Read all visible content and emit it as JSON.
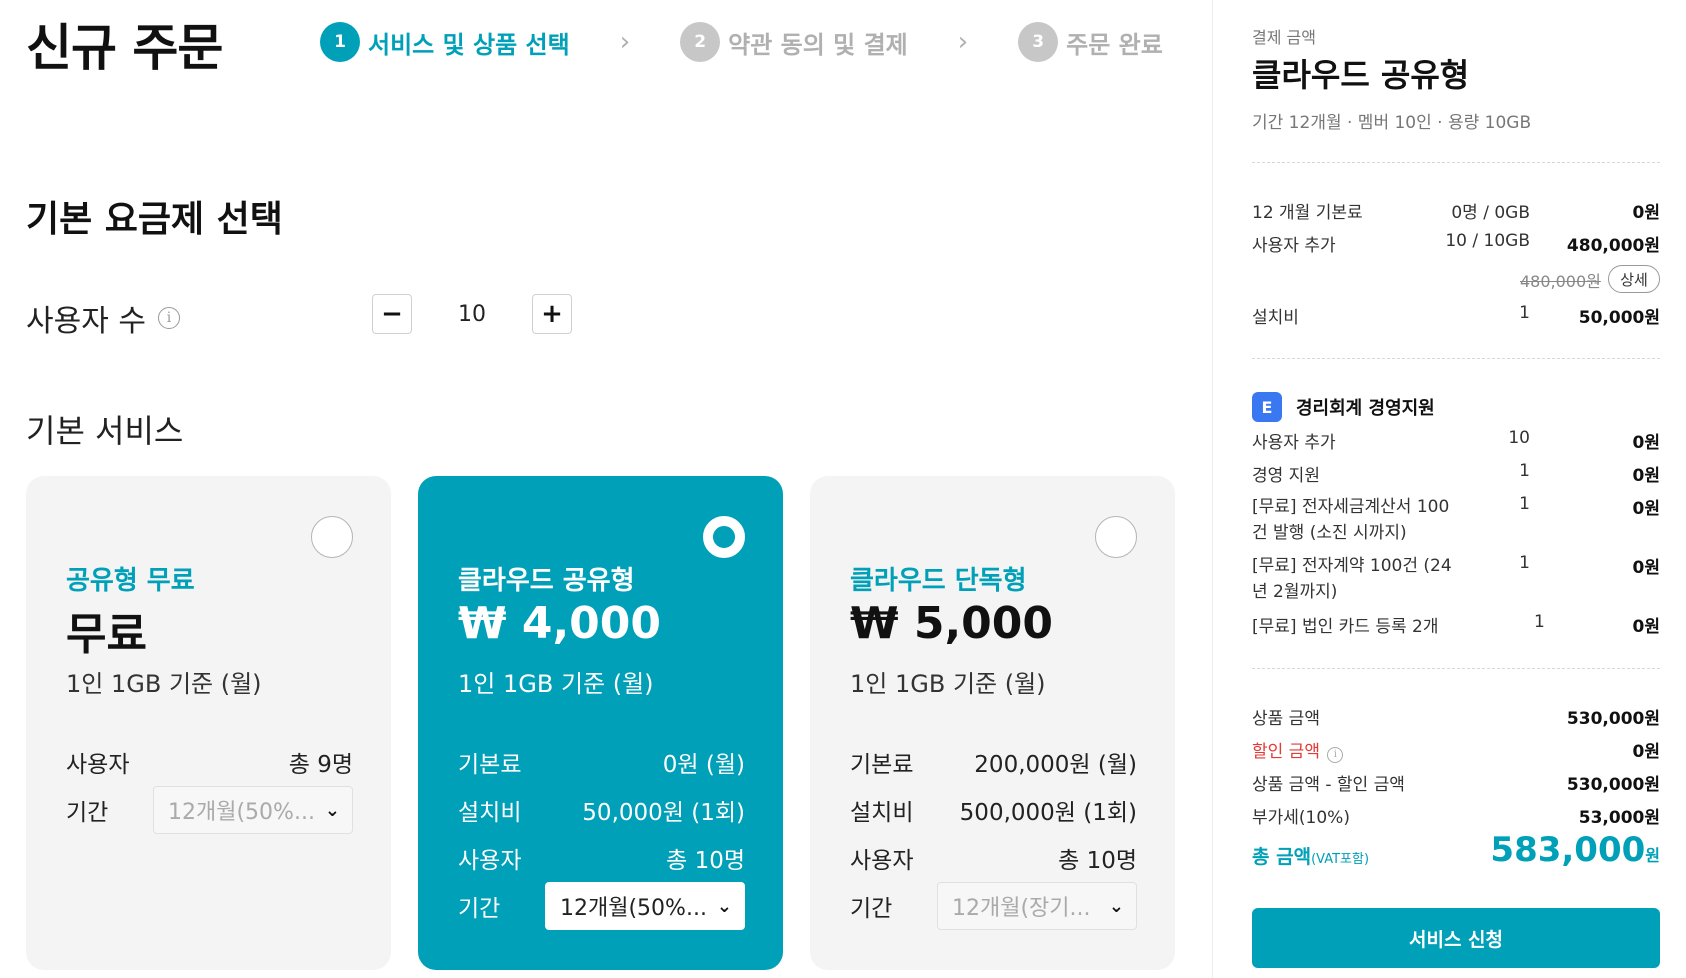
{
  "header": {
    "title": "신규 주문",
    "steps": [
      {
        "num": "1",
        "label": "서비스 및 상품 선택"
      },
      {
        "num": "2",
        "label": "약관 동의 및 결제"
      },
      {
        "num": "3",
        "label": "주문 완료"
      }
    ],
    "arrow": "›"
  },
  "plan_section": {
    "title": "기본 요금제 선택",
    "user_count_label": "사용자 수",
    "info_glyph": "i",
    "minus": "−",
    "plus": "+",
    "user_count": "10",
    "basic_service_title": "기본 서비스"
  },
  "cards": [
    {
      "name": "공유형 무료",
      "price": "무료",
      "basis": "1인 1GB 기준 (월)",
      "rows": [
        {
          "label": "사용자",
          "value": "총 9명"
        }
      ],
      "period_label": "기간",
      "period_value": "12개월(50%...",
      "selected": false
    },
    {
      "name": "클라우드 공유형",
      "price": "₩ 4,000",
      "basis": "1인 1GB 기준 (월)",
      "rows": [
        {
          "label": "기본료",
          "value": "0원 (월)"
        },
        {
          "label": "설치비",
          "value": "50,000원 (1회)"
        },
        {
          "label": "사용자",
          "value": "총 10명"
        }
      ],
      "period_label": "기간",
      "period_value": "12개월(50%...",
      "selected": true
    },
    {
      "name": "클라우드 단독형",
      "price": "₩ 5,000",
      "basis": "1인 1GB 기준 (월)",
      "rows": [
        {
          "label": "기본료",
          "value": "200,000원 (월)"
        },
        {
          "label": "설치비",
          "value": "500,000원 (1회)"
        },
        {
          "label": "사용자",
          "value": "총 10명"
        }
      ],
      "period_label": "기간",
      "period_value": "12개월(장기...",
      "selected": false
    }
  ],
  "summary": {
    "label": "결제 금액",
    "title": "클라우드 공유형",
    "sub": "기간 12개월 · 멤버 10인 · 용량 10GB",
    "lines": [
      {
        "name": "12 개월 기본료",
        "qty": "0명 / 0GB",
        "price": "0원"
      },
      {
        "name": "사용자 추가",
        "qty": "10 / 10GB",
        "price": "480,000원"
      },
      {
        "name": "설치비",
        "qty": "1",
        "price": "50,000원"
      }
    ],
    "strike_price": "480,000원",
    "detail_button": "상세",
    "addon": {
      "icon_glyph": "E",
      "title": "경리회계 경영지원",
      "lines": [
        {
          "name": "사용자 추가",
          "qty": "10",
          "price": "0원"
        },
        {
          "name": "경영 지원",
          "qty": "1",
          "price": "0원"
        },
        {
          "name": "[무료] 전자세금계산서 100건 발행 (소진 시까지)",
          "qty": "1",
          "price": "0원"
        },
        {
          "name": "[무료] 전자계약 100건 (24년 2월까지)",
          "qty": "1",
          "price": "0원"
        },
        {
          "name": "[무료] 법인 카드 등록 2개",
          "qty": "1",
          "price": "0원"
        }
      ]
    },
    "totals": [
      {
        "label": "상품 금액",
        "value": "530,000원"
      },
      {
        "label": "할인 금액",
        "value": "0원"
      },
      {
        "label": "상품 금액 - 할인 금액",
        "value": "530,000원"
      },
      {
        "label": "부가세(10%)",
        "value": "53,000원"
      }
    ],
    "total_label": "총 금액",
    "total_label_suffix": "(VAT포함)",
    "total_value": "583,000",
    "total_unit": "원",
    "apply_button": "서비스 신청"
  },
  "colors": {
    "accent": "#00a0b8",
    "discount": "#e53935",
    "card_bg": "#f4f4f4"
  }
}
